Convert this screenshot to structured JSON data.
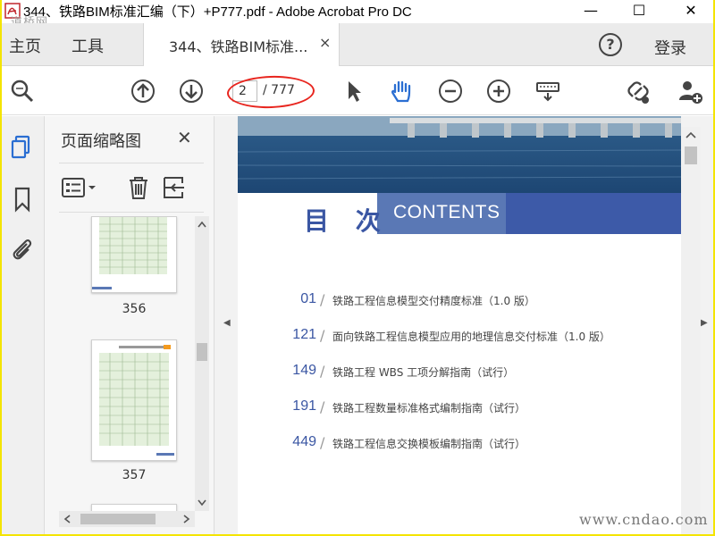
{
  "window": {
    "title": "344、铁路BIM标准汇编（下）+P777.pdf - Adobe Acrobat Pro DC",
    "watermark_top": "道桥网",
    "controls": {
      "minimize": "—",
      "maximize": "☐",
      "close": "✕"
    }
  },
  "menubar": {
    "home": "主页",
    "tools": "工具",
    "doc_tab": "344、铁路BIM标准...",
    "doc_tab_close": "×",
    "help": "?",
    "login": "登录"
  },
  "toolbar": {
    "page_current": "2",
    "page_total": "/ 777"
  },
  "thumbnail_pane": {
    "title": "页面缩略图",
    "close": "✕",
    "thumbnails": [
      {
        "label": "356"
      },
      {
        "label": "357"
      }
    ]
  },
  "document": {
    "toc_heading": "目 次",
    "contents_label": "CONTENTS",
    "toc": [
      {
        "page": "01",
        "title": "铁路工程信息模型交付精度标准（1.0 版）"
      },
      {
        "page": "121",
        "title": "面向铁路工程信息模型应用的地理信息交付标准（1.0 版）"
      },
      {
        "page": "149",
        "title": "铁路工程 WBS 工项分解指南（试行）"
      },
      {
        "page": "191",
        "title": "铁路工程数量标准格式编制指南（试行）"
      },
      {
        "page": "449",
        "title": "铁路工程信息交换模板编制指南（试行）"
      }
    ]
  },
  "watermark_bottom": "www.cndao.com",
  "colors": {
    "frame": "#f4e400",
    "accent_blue": "#3a56a3",
    "band_light": "#5a78b5",
    "annotation_red": "#e8251e",
    "icon_blue": "#2a6ed2"
  }
}
